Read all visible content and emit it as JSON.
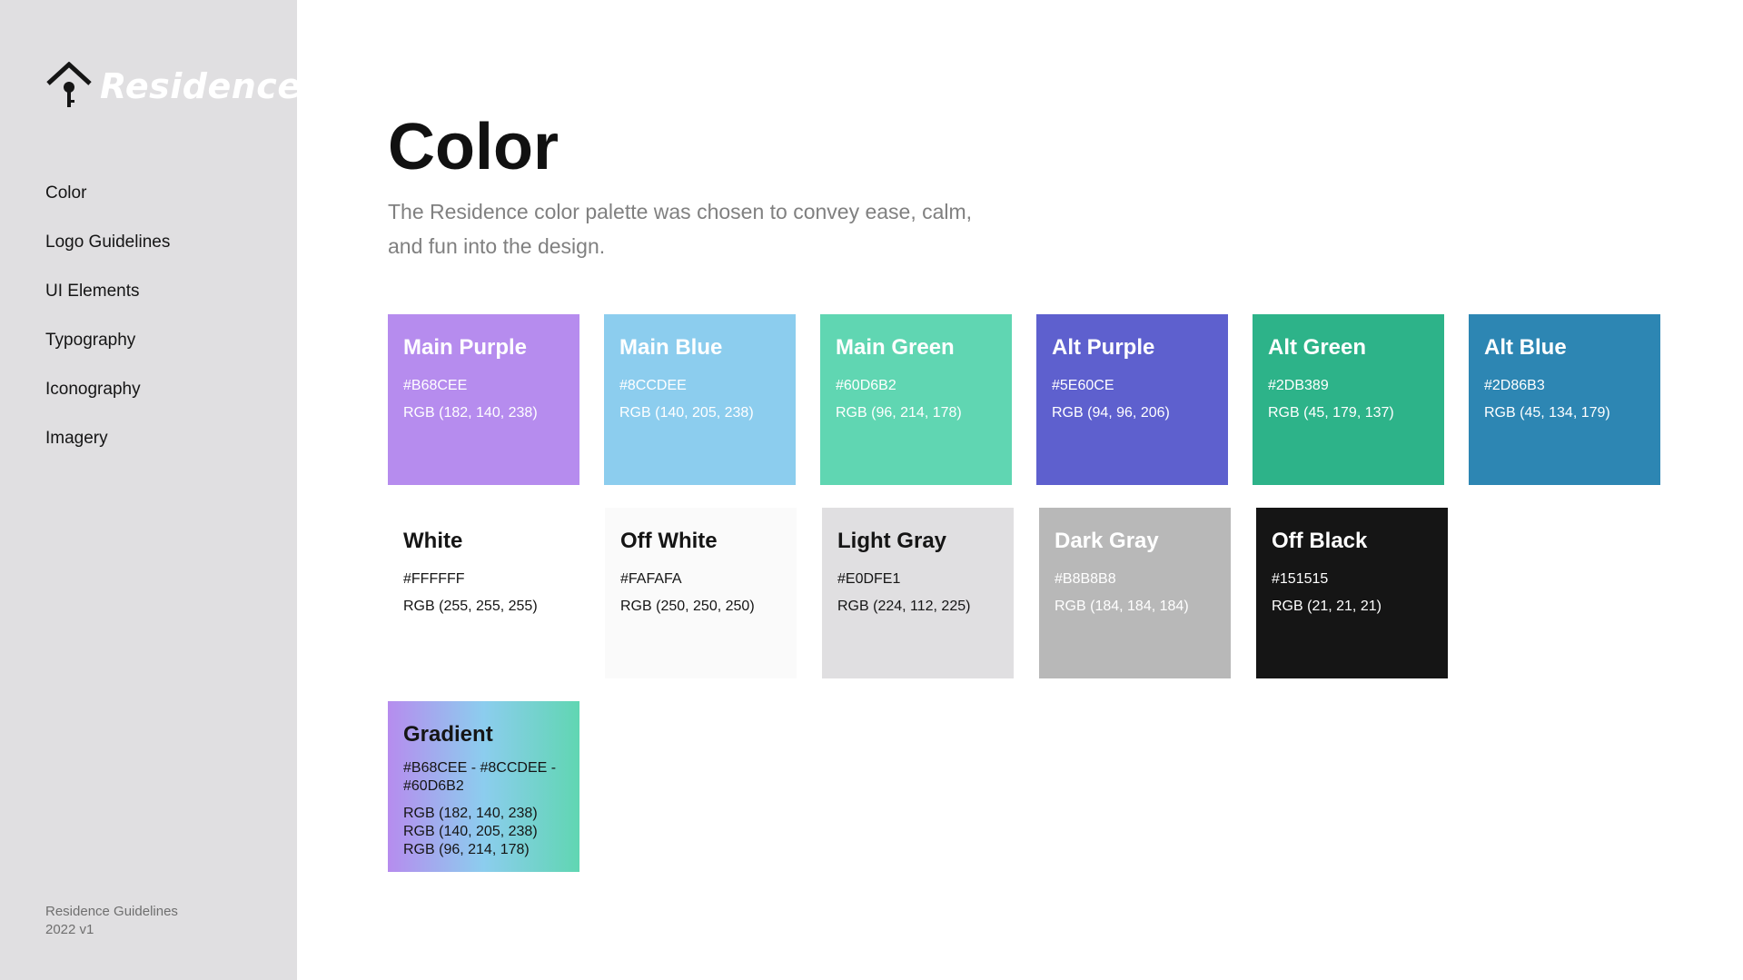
{
  "sidebar": {
    "logo_text": "Residence",
    "nav": [
      "Color",
      "Logo Guidelines",
      "UI Elements",
      "Typography",
      "Iconography",
      "Imagery"
    ],
    "footer": {
      "line1": "Residence Guidelines",
      "line2": "2022 v1"
    }
  },
  "main": {
    "title": "Color",
    "subtitle": "The Residence color palette was chosen to convey ease, calm, and fun into the design."
  },
  "swatches": [
    {
      "name": "Main Purple",
      "hex": "#B68CEE",
      "rgb": "RGB (182, 140, 238)",
      "bg": "#b68cee",
      "fg": "#ffffff"
    },
    {
      "name": "Main Blue",
      "hex": "#8CCDEE",
      "rgb": "RGB (140, 205, 238)",
      "bg": "#8ccdee",
      "fg": "#ffffff"
    },
    {
      "name": "Main Green",
      "hex": "#60D6B2",
      "rgb": "RGB (96, 214, 178)",
      "bg": "#60d6b2",
      "fg": "#ffffff"
    },
    {
      "name": "Alt Purple",
      "hex": "#5E60CE",
      "rgb": "RGB (94, 96, 206)",
      "bg": "#5e60ce",
      "fg": "#ffffff"
    },
    {
      "name": "Alt Green",
      "hex": "#2DB389",
      "rgb": "RGB (45, 179, 137)",
      "bg": "#2db389",
      "fg": "#ffffff"
    },
    {
      "name": "Alt Blue",
      "hex": "#2D86B3",
      "rgb": "RGB (45, 134, 179)",
      "bg": "#2d86b3",
      "fg": "#ffffff"
    },
    {
      "name": "White",
      "hex": "#FFFFFF",
      "rgb": "RGB (255, 255, 255)",
      "bg": "#ffffff",
      "fg": "#151515"
    },
    {
      "name": "Off White",
      "hex": "#FAFAFA",
      "rgb": "RGB (250, 250, 250)",
      "bg": "#fafafa",
      "fg": "#151515"
    },
    {
      "name": "Light Gray",
      "hex": "#E0DFE1",
      "rgb": "RGB (224, 112, 225)",
      "bg": "#e0dfe1",
      "fg": "#151515"
    },
    {
      "name": "Dark Gray",
      "hex": "#B8B8B8",
      "rgb": "RGB (184, 184, 184)",
      "bg": "#b8b8b8",
      "fg": "#ffffff"
    },
    {
      "name": "Off Black",
      "hex": "#151515",
      "rgb": "RGB (21, 21, 21)",
      "bg": "#151515",
      "fg": "#ffffff"
    }
  ],
  "gradient": {
    "name": "Gradient",
    "hex": "#B68CEE - #8CCDEE - #60D6B2",
    "rgb1": "RGB (182, 140, 238)",
    "rgb2": "RGB (140, 205, 238)",
    "rgb3": "RGB (96, 214, 178)",
    "fg": "#151515",
    "colors": [
      "#b68cee",
      "#8ccdee",
      "#60d6b2"
    ]
  }
}
